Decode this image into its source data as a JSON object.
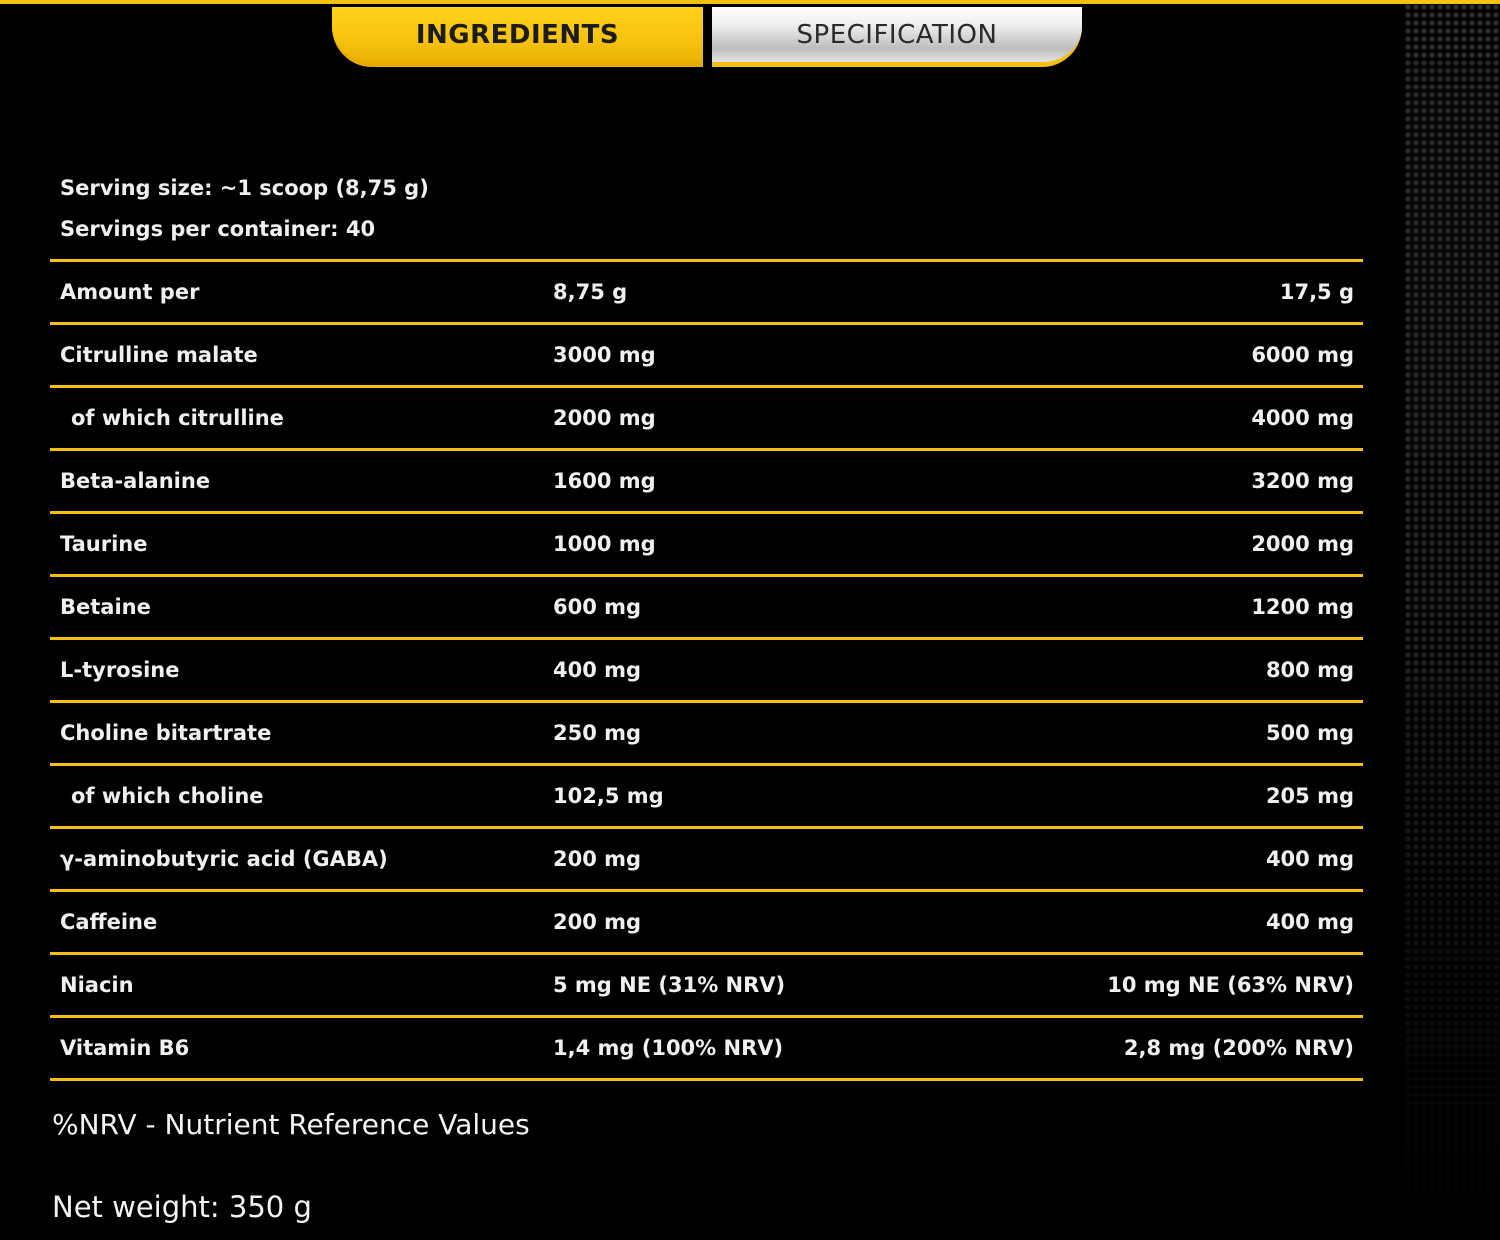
{
  "tabs": {
    "ingredients": "INGREDIENTS",
    "specification": "SPECIFICATION"
  },
  "serving": {
    "size": "Serving size: ~1 scoop (8,75 g)",
    "per_container": "Servings per container: 40"
  },
  "table": {
    "rows": [
      {
        "name": "Amount per",
        "v1": "8,75 g",
        "v2": "17,5 g"
      },
      {
        "name": "Citrulline malate",
        "v1": "3000 mg",
        "v2": "6000 mg"
      },
      {
        "name": "of which citrulline",
        "v1": "2000 mg",
        "v2": "4000 mg"
      },
      {
        "name": "Beta-alanine",
        "v1": "1600 mg",
        "v2": "3200 mg"
      },
      {
        "name": "Taurine",
        "v1": "1000 mg",
        "v2": "2000 mg"
      },
      {
        "name": "Betaine",
        "v1": "600 mg",
        "v2": "1200 mg"
      },
      {
        "name": "L-tyrosine",
        "v1": "400 mg",
        "v2": "800 mg"
      },
      {
        "name": "Choline bitartrate",
        "v1": "250 mg",
        "v2": "500 mg"
      },
      {
        "name": "of which choline",
        "v1": "102,5 mg",
        "v2": "205 mg"
      },
      {
        "name": "γ-aminobutyric acid (GABA)",
        "v1": "200 mg",
        "v2": "400 mg"
      },
      {
        "name": "Caffeine",
        "v1": "200 mg",
        "v2": "400 mg"
      },
      {
        "name": "Niacin",
        "v1": "5 mg NE (31% NRV)",
        "v2": "10 mg NE (63% NRV)"
      },
      {
        "name": "Vitamin B6",
        "v1": "1,4 mg (100% NRV)",
        "v2": "2,8 mg (200% NRV)"
      }
    ]
  },
  "footer": {
    "nrv_note": "%NRV - Nutrient Reference Values",
    "net_weight": "Net weight: 350 g"
  },
  "colors": {
    "accent": "#f5c012",
    "background": "#000000",
    "text": "#f0f0f0"
  }
}
